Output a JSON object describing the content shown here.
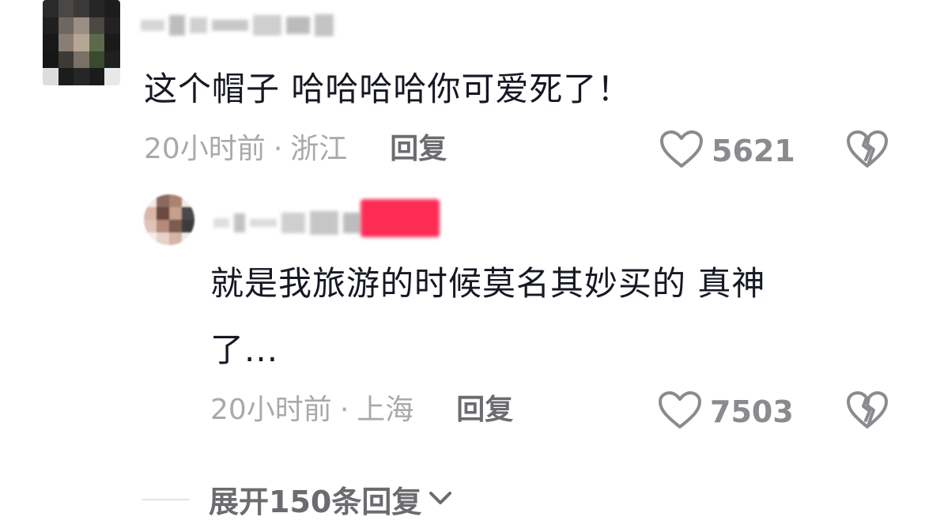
{
  "comments": [
    {
      "text": "这个帽子 哈哈哈哈你可爱死了！",
      "time": "20小时前",
      "separator": "·",
      "location": "浙江",
      "reply_label": "回复",
      "likes": "5621"
    },
    {
      "text_line1": "就是我旅游的时候莫名其妙买的 真神",
      "text_line2": "了...",
      "time": "20小时前",
      "separator": "·",
      "location": "上海",
      "reply_label": "回复",
      "likes": "7503"
    }
  ],
  "expand_replies": "展开150条回复",
  "icons": {
    "like": "heart-outline-icon",
    "dislike": "broken-heart-icon",
    "expand": "chevron-down-icon"
  },
  "colors": {
    "text": "#161823",
    "meta": "#a9a9ac",
    "action": "#6b6b70",
    "badge": "#fe2c55"
  }
}
